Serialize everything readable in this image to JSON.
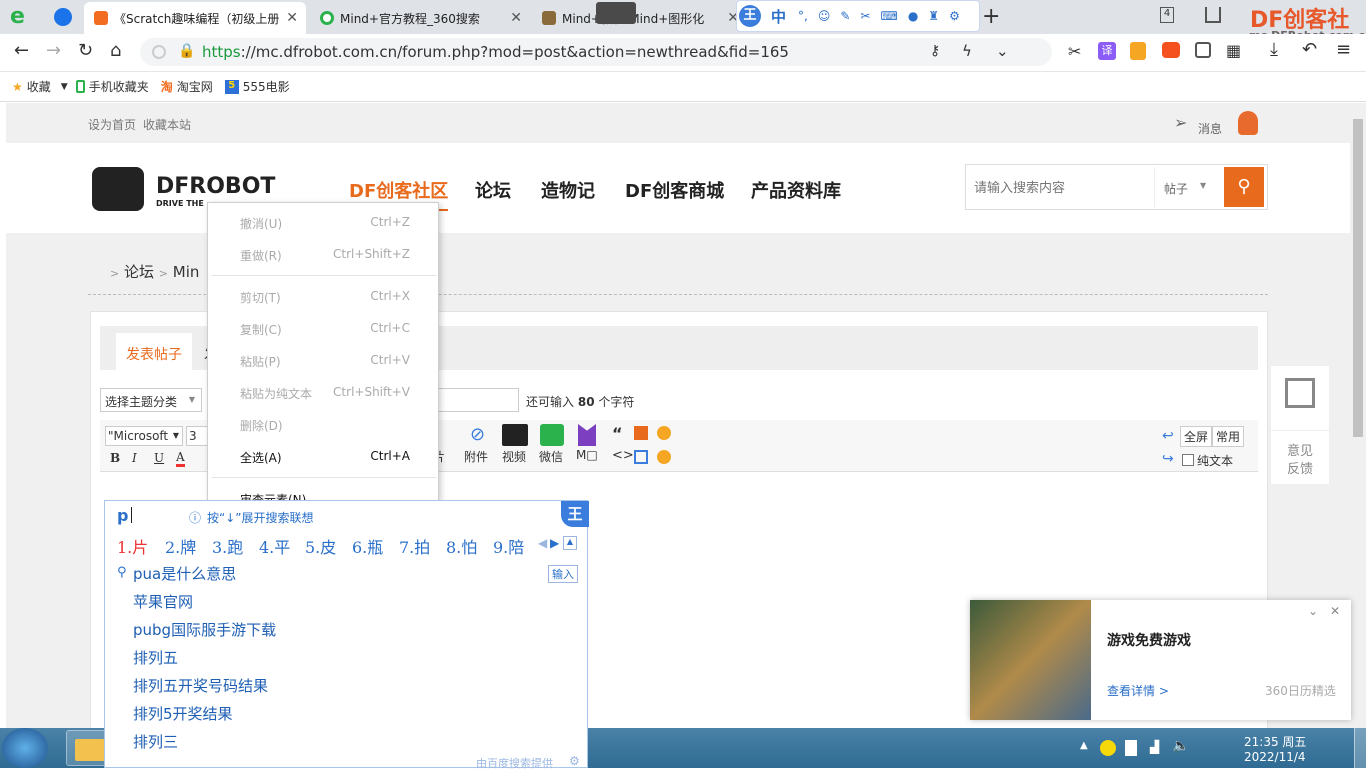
{
  "browser": {
    "tabs": [
      {
        "label": "《Scratch趣味编程（初级上册",
        "active": true
      },
      {
        "label": "Mind+官方教程_360搜索",
        "active": false
      },
      {
        "label": "Mind+教程-Mind+图形化",
        "active": false
      }
    ],
    "tab_count": "4",
    "brand_name": "DF创客社区",
    "brand_url": "mc.DFRobot.com.cn",
    "url_scheme": "https",
    "url_rest": "://mc.dfrobot.com.cn/forum.php?mod=post&action=newthread&fid=165",
    "translate_btn": "译",
    "bookmarks": [
      {
        "label": "收藏",
        "icon": "star-icon"
      },
      {
        "label": "手机收藏夹",
        "icon": "phone-icon"
      },
      {
        "label": "淘宝网",
        "icon": "taobao-icon"
      },
      {
        "label": "555电影",
        "icon": "film-icon"
      }
    ]
  },
  "ime_toolbar": {
    "mode": "中"
  },
  "site": {
    "top_links": [
      "设为首页",
      "收藏本站"
    ],
    "messages": "消息",
    "logo_text": "DFROBOT",
    "logo_tag": "DRIVE THE",
    "nav": [
      "DF创客社区",
      "论坛",
      "造物记",
      "DF创客商城",
      "产品资料库"
    ],
    "search_placeholder": "请输入搜索内容",
    "search_type": "帖子",
    "breadcrumb": [
      ">",
      "论坛",
      ">",
      "Min"
    ],
    "tab_post": "发表帖子",
    "tab_post_2": "发",
    "category_select": "选择主题分类",
    "chars_left_prefix": "还可输入",
    "chars_left": "80",
    "chars_left_suffix": "个字符",
    "font_select": "\"Microsoft",
    "size_select": "3",
    "toolbar_btns": [
      "片",
      "附件",
      "视频",
      "微信",
      "M□"
    ],
    "fullscreen": "全屏",
    "common": "常用",
    "plain_text": "纯文本",
    "side_feedback": [
      "意见",
      "反馈"
    ],
    "format_btns": [
      "B",
      "I",
      "U",
      "A"
    ]
  },
  "context_menu": {
    "items": [
      {
        "label": "撤消(U)",
        "shortcut": "Ctrl+Z",
        "enabled": false
      },
      {
        "label": "重做(R)",
        "shortcut": "Ctrl+Shift+Z",
        "enabled": false
      },
      {
        "label": "剪切(T)",
        "shortcut": "Ctrl+X",
        "enabled": false
      },
      {
        "label": "复制(C)",
        "shortcut": "Ctrl+C",
        "enabled": false
      },
      {
        "label": "粘贴(P)",
        "shortcut": "Ctrl+V",
        "enabled": false
      },
      {
        "label": "粘贴为纯文本",
        "shortcut": "Ctrl+Shift+V",
        "enabled": false
      },
      {
        "label": "删除(D)",
        "shortcut": "",
        "enabled": false
      },
      {
        "label": "全选(A)",
        "shortcut": "Ctrl+A",
        "enabled": true
      },
      {
        "label": "审查元素(N)",
        "shortcut": "",
        "enabled": true
      }
    ]
  },
  "ime": {
    "input": "p",
    "hint": "按“↓”展开搜索联想",
    "candidates": [
      "1.片",
      "2.牌",
      "3.跑",
      "4.平",
      "5.皮",
      "6.瓶",
      "7.拍",
      "8.怕",
      "9.陪"
    ],
    "suggestions": [
      "pua是什么意思",
      "苹果官网",
      "pubg国际服手游下载",
      "排列五",
      "排列五开奖号码结果",
      "排列5开奖结果",
      "排列三"
    ],
    "enter_btn": "输入",
    "provider": "由百度搜索提供",
    "logo": "王"
  },
  "ad": {
    "title": "游戏免费游戏",
    "link": "查看详情 >",
    "source": "360日历精选"
  },
  "taskbar": {
    "time": "21:35 周五",
    "date": "2022/11/4"
  }
}
